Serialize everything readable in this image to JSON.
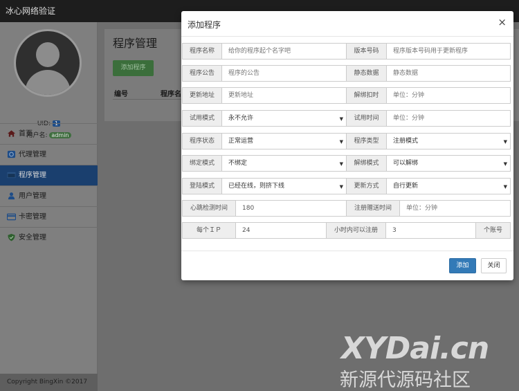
{
  "topbar": {
    "brand": "冰心网络验证"
  },
  "sidebar": {
    "uid_label": "UID:",
    "uid_value": "1",
    "user_label": "用户名:",
    "user_value": "admin",
    "items": [
      {
        "label": "首页",
        "icon": "home-icon"
      },
      {
        "label": "代理管理",
        "icon": "agent-icon"
      },
      {
        "label": "程序管理",
        "icon": "program-icon",
        "active": true
      },
      {
        "label": "用户管理",
        "icon": "user-icon"
      },
      {
        "label": "卡密管理",
        "icon": "card-icon"
      },
      {
        "label": "安全管理",
        "icon": "shield-icon"
      }
    ],
    "footer": "Copyright BingXin ©2017"
  },
  "content": {
    "title": "程序管理",
    "add_button": "添加程序",
    "columns": [
      "编号",
      "程序名"
    ]
  },
  "modal": {
    "title": "添加程序",
    "close": "×",
    "fields": {
      "name_label": "程序名称",
      "name_placeholder": "给你的程序起个名字吧",
      "version_label": "版本号码",
      "version_placeholder": "程序版本号码用于更新程序",
      "notice_label": "程序公告",
      "notice_placeholder": "程序的公告",
      "static_label": "静态数据",
      "static_placeholder": "静态数据",
      "update_url_label": "更新地址",
      "update_url_placeholder": "更新地址",
      "unbind_deduct_label": "解绑扣时",
      "unbind_deduct_placeholder": "单位：分钟",
      "trial_mode_label": "试用模式",
      "trial_mode_value": "永不允许",
      "trial_time_label": "试用时间",
      "trial_time_placeholder": "单位：分钟",
      "status_label": "程序状态",
      "status_value": "正常运营",
      "type_label": "程序类型",
      "type_value": "注册模式",
      "bind_mode_label": "绑定模式",
      "bind_mode_value": "不绑定",
      "unbind_mode_label": "解绑模式",
      "unbind_mode_value": "可以解绑",
      "login_mode_label": "登陆模式",
      "login_mode_value": "已经在线，则挤下线",
      "update_mode_label": "更新方式",
      "update_mode_value": "自行更新",
      "heartbeat_label": "心跳检测时间",
      "heartbeat_value": "180",
      "reg_gift_label": "注册赠送时间",
      "reg_gift_placeholder": "单位：分钟",
      "per_ip_label": "每个ＩＰ",
      "per_ip_value": "24",
      "hours_label": "小时内可以注册",
      "hours_value": "3",
      "accounts_label": "个账号"
    },
    "add_button": "添加",
    "close_button": "关闭"
  },
  "watermark": {
    "line1": "XYDai.cn",
    "line2": "新源代源码社区"
  }
}
